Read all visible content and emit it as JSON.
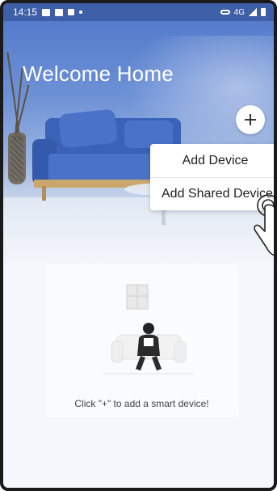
{
  "status_bar": {
    "time": "14:15",
    "network": "4G"
  },
  "header": {
    "title": "Welcome Home"
  },
  "add_menu": {
    "items": [
      {
        "label": "Add Device"
      },
      {
        "label": "Add Shared Device"
      }
    ]
  },
  "empty_state": {
    "message": "Click \"+\" to add a smart device!"
  },
  "colors": {
    "hero_blue": "#4f77c9",
    "status_bar": "#3e5fa8",
    "menu_bg": "#ffffff"
  },
  "icons": {
    "add": "plus-icon",
    "pointer": "hand-pointer-icon"
  }
}
